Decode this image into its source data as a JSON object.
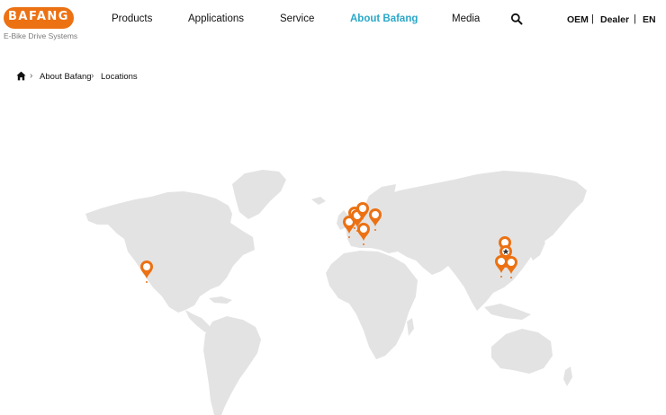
{
  "brand": {
    "name": "BAFANG",
    "tagline": "E-Bike Drive Systems",
    "color": "#ec7113"
  },
  "nav": {
    "items": [
      "Products",
      "Applications",
      "Service",
      "About Bafang",
      "Media"
    ],
    "active": "About Bafang",
    "active_color": "#2aa8c8"
  },
  "utility": {
    "oem": "OEM",
    "sep": "|",
    "dealer": "Dealer",
    "lang": "EN"
  },
  "breadcrumb": {
    "items": [
      "About Bafang",
      "Locations"
    ]
  },
  "map": {
    "land_color": "#e3e3e3",
    "pin_color": "#ec7113",
    "locations": [
      {
        "name": "USA West"
      },
      {
        "name": "Netherlands 1"
      },
      {
        "name": "Netherlands 2"
      },
      {
        "name": "Germany North"
      },
      {
        "name": "Germany"
      },
      {
        "name": "Poland"
      },
      {
        "name": "Italy / Switzerland"
      },
      {
        "name": "China North"
      },
      {
        "name": "China HQ"
      },
      {
        "name": "China South"
      },
      {
        "name": "Taiwan"
      }
    ]
  }
}
